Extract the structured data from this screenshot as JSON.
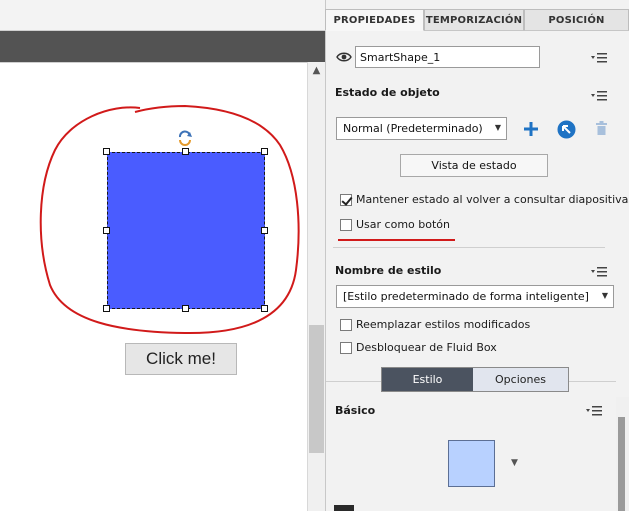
{
  "tabs": [
    {
      "label": "PROPIEDADES",
      "active": true
    },
    {
      "label": "TEMPORIZACIÓN",
      "active": false
    },
    {
      "label": "POSICIÓN",
      "active": false
    }
  ],
  "object": {
    "name": "SmartShape_1"
  },
  "object_state": {
    "title": "Estado de objeto",
    "selected_state": "Normal (Predeterminado)",
    "state_view_button": "Vista de estado",
    "retain_state_label": "Mantener estado al volver a consultar diapositivas",
    "retain_state_checked": true,
    "use_as_button_label": "Usar como botón",
    "use_as_button_checked": false
  },
  "style": {
    "title": "Nombre de estilo",
    "selected_style": "[Estilo predeterminado de forma inteligente]",
    "replace_modified_label": "Reemplazar estilos modificados",
    "replace_modified_checked": false,
    "unlock_fluid_box_label": "Desbloquear de Fluid Box",
    "unlock_fluid_box_checked": false
  },
  "toggle": {
    "style_label": "Estilo",
    "options_label": "Opciones",
    "active": "Estilo"
  },
  "basic": {
    "title": "Básico",
    "fill_color": "#b8d1ff"
  },
  "stage": {
    "shape_color": "#4a5cff",
    "button_label": "Click me!",
    "annotation_color": "#d11a1a"
  },
  "colors": {
    "accent_blue": "#1f73c4",
    "dark_bar": "#535353"
  }
}
